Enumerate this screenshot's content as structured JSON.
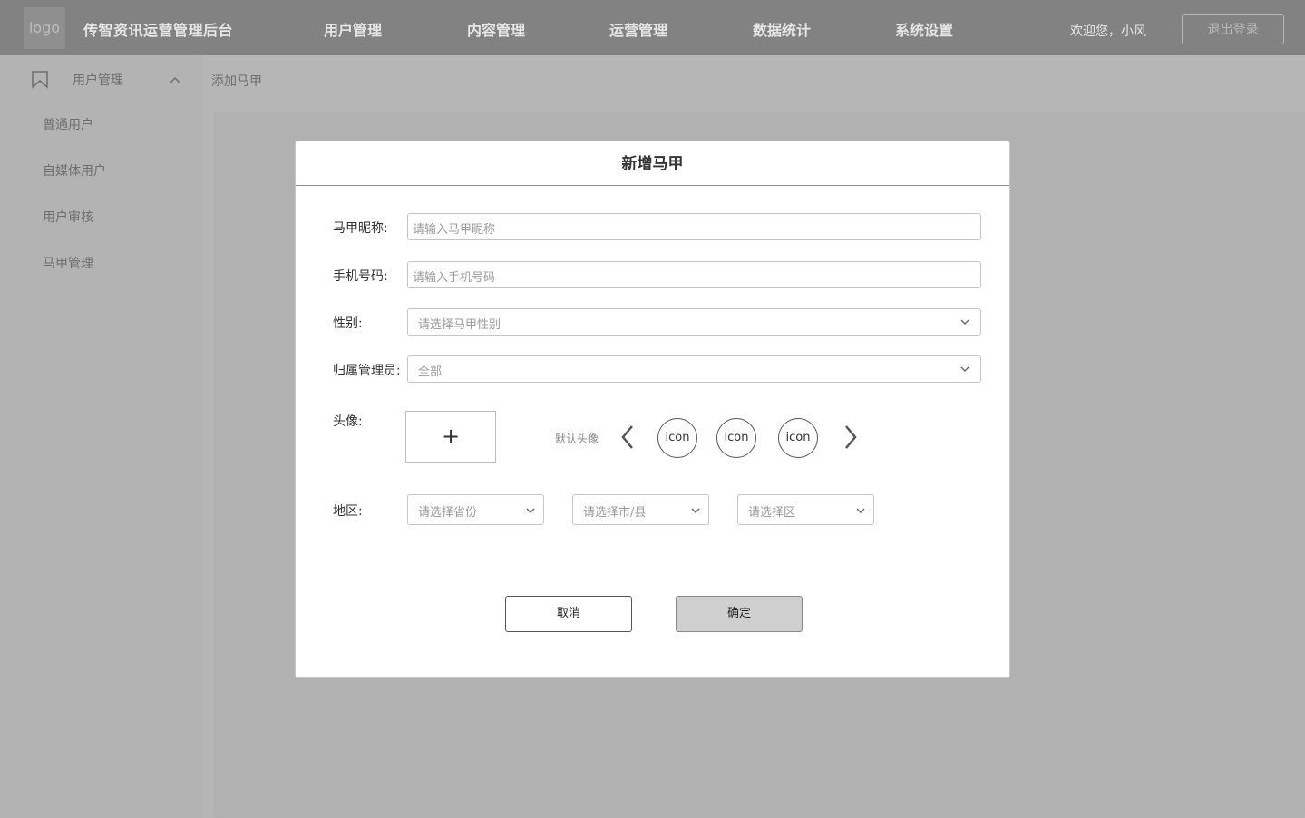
{
  "header": {
    "logo_text": "logo",
    "app_title": "传智资讯运营管理后台",
    "nav": [
      "用户管理",
      "内容管理",
      "运营管理",
      "数据统计",
      "系统设置"
    ],
    "welcome": "欢迎您，小风",
    "logout_label": "退出登录"
  },
  "sidebar": {
    "group_label": "用户管理",
    "items": [
      "普通用户",
      "自媒体用户",
      "用户审核",
      "马甲管理"
    ]
  },
  "breadcrumb": "添加马甲",
  "modal": {
    "title": "新增马甲",
    "nickname": {
      "label": "马甲昵称:",
      "placeholder": "请输入马甲昵称"
    },
    "phone": {
      "label": "手机号码:",
      "placeholder": "请输入手机号码"
    },
    "gender": {
      "label": "性别:",
      "placeholder": "请选择马甲性别"
    },
    "admin": {
      "label": "归属管理员:",
      "value": "全部"
    },
    "avatar": {
      "label": "头像:",
      "upload_symbol": "+",
      "default_label": "默认头像",
      "options": [
        "icon",
        "icon",
        "icon"
      ]
    },
    "region": {
      "label": "地区:",
      "province_placeholder": "请选择省份",
      "city_placeholder": "请选择市/县",
      "district_placeholder": "请选择区"
    },
    "cancel_label": "取消",
    "confirm_label": "确定"
  }
}
